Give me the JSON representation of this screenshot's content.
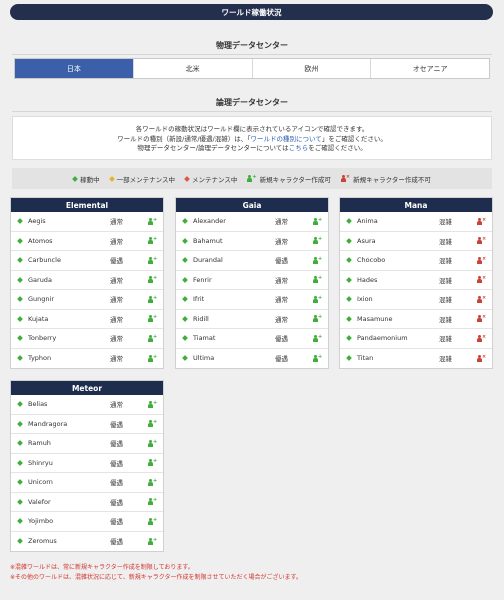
{
  "header": {
    "title": "ワールド稼働状況"
  },
  "physical": {
    "heading": "物理データセンター",
    "tabs": [
      {
        "label": "日本",
        "active": true
      },
      {
        "label": "北米",
        "active": false
      },
      {
        "label": "欧州",
        "active": false
      },
      {
        "label": "オセアニア",
        "active": false
      }
    ]
  },
  "logical": {
    "heading": "論理データセンター",
    "info_line1": "各ワールドの稼動状況はワールド欄に表示されているアイコンで確認できます。",
    "info_line2_pre": "ワールドの種別（新設/通常/優遇/混雑）は、「",
    "info_line2_link": "ワールドの種別について",
    "info_line2_post": "」をご確認ください。",
    "info_line3_pre": "物理データセンター/論理データセンターについては",
    "info_line3_link": "こちら",
    "info_line3_post": "をご確認ください。"
  },
  "legend": {
    "online": "稼動中",
    "partial": "一部メンテナンス中",
    "maintenance": "メンテナンス中",
    "creation_ok": "新規キャラクター作成可",
    "creation_ng": "新規キャラクター作成不可",
    "plus": "+",
    "cross": "×"
  },
  "colors": {
    "header_bg": "#232f4d",
    "tab_active": "#3b60a9",
    "online": "#3fae3a",
    "ng": "#c7443a",
    "note": "#d0342c"
  },
  "datacenters": [
    {
      "name": "Elemental",
      "worlds": [
        {
          "name": "Aegis",
          "status": "通常",
          "creation": "ok"
        },
        {
          "name": "Atomos",
          "status": "通常",
          "creation": "ok"
        },
        {
          "name": "Carbuncle",
          "status": "優遇",
          "creation": "ok"
        },
        {
          "name": "Garuda",
          "status": "通常",
          "creation": "ok"
        },
        {
          "name": "Gungnir",
          "status": "通常",
          "creation": "ok"
        },
        {
          "name": "Kujata",
          "status": "通常",
          "creation": "ok"
        },
        {
          "name": "Tonberry",
          "status": "通常",
          "creation": "ok"
        },
        {
          "name": "Typhon",
          "status": "通常",
          "creation": "ok"
        }
      ]
    },
    {
      "name": "Gaia",
      "worlds": [
        {
          "name": "Alexander",
          "status": "通常",
          "creation": "ok"
        },
        {
          "name": "Bahamut",
          "status": "通常",
          "creation": "ok"
        },
        {
          "name": "Durandal",
          "status": "優遇",
          "creation": "ok"
        },
        {
          "name": "Fenrir",
          "status": "通常",
          "creation": "ok"
        },
        {
          "name": "Ifrit",
          "status": "通常",
          "creation": "ok"
        },
        {
          "name": "Ridill",
          "status": "通常",
          "creation": "ok"
        },
        {
          "name": "Tiamat",
          "status": "優遇",
          "creation": "ok"
        },
        {
          "name": "Ultima",
          "status": "優遇",
          "creation": "ok"
        }
      ]
    },
    {
      "name": "Mana",
      "worlds": [
        {
          "name": "Anima",
          "status": "混雑",
          "creation": "ng"
        },
        {
          "name": "Asura",
          "status": "混雑",
          "creation": "ng"
        },
        {
          "name": "Chocobo",
          "status": "混雑",
          "creation": "ng"
        },
        {
          "name": "Hades",
          "status": "混雑",
          "creation": "ng"
        },
        {
          "name": "Ixion",
          "status": "混雑",
          "creation": "ng"
        },
        {
          "name": "Masamune",
          "status": "混雑",
          "creation": "ng"
        },
        {
          "name": "Pandaemonium",
          "status": "混雑",
          "creation": "ng"
        },
        {
          "name": "Titan",
          "status": "混雑",
          "creation": "ng"
        }
      ]
    },
    {
      "name": "Meteor",
      "worlds": [
        {
          "name": "Belias",
          "status": "通常",
          "creation": "ok"
        },
        {
          "name": "Mandragora",
          "status": "優遇",
          "creation": "ok"
        },
        {
          "name": "Ramuh",
          "status": "優遇",
          "creation": "ok"
        },
        {
          "name": "Shinryu",
          "status": "優遇",
          "creation": "ok"
        },
        {
          "name": "Unicorn",
          "status": "優遇",
          "creation": "ok"
        },
        {
          "name": "Valefor",
          "status": "優遇",
          "creation": "ok"
        },
        {
          "name": "Yojimbo",
          "status": "優遇",
          "creation": "ok"
        },
        {
          "name": "Zeromus",
          "status": "優遇",
          "creation": "ok"
        }
      ]
    }
  ],
  "notes": [
    "※混雑ワールドは、常に新規キャラクター作成を制限しております。",
    "※その他のワールドは、混雑状況に応じて、新規キャラクター作成を制限させていただく場合がございます。"
  ]
}
